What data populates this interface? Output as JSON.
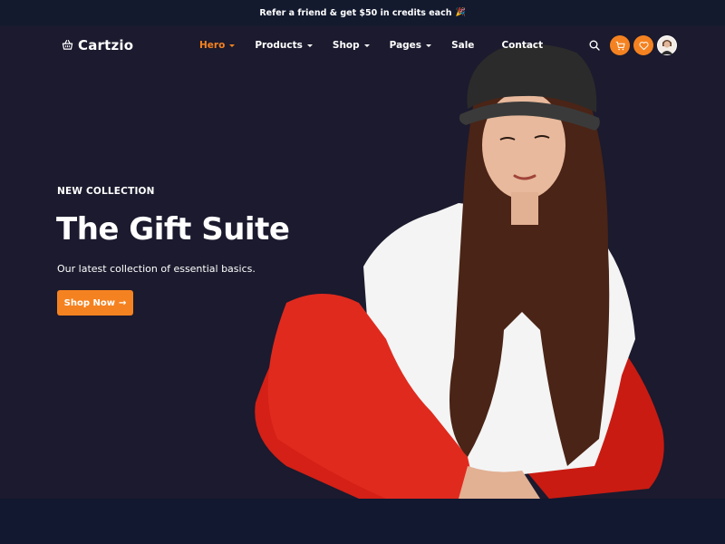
{
  "promo": {
    "text": "Refer a friend & get $50 in credits each",
    "emoji": "🎉"
  },
  "brand": {
    "name": "Cartzio",
    "icon": "basket-icon"
  },
  "nav": {
    "items": [
      {
        "label": "Hero",
        "active": true,
        "dropdown": true
      },
      {
        "label": "Products",
        "active": false,
        "dropdown": true
      },
      {
        "label": "Shop",
        "active": false,
        "dropdown": true
      },
      {
        "label": "Pages",
        "active": false,
        "dropdown": true
      },
      {
        "label": "Sale",
        "active": false,
        "dropdown": false
      },
      {
        "label": "Contact",
        "active": false,
        "dropdown": false
      }
    ],
    "actions": [
      "search-icon",
      "cart-icon",
      "heart-icon",
      "avatar"
    ]
  },
  "hero": {
    "eyebrow": "NEW COLLECTION",
    "title": "The Gift Suite",
    "subtitle": "Our latest collection of essential basics.",
    "cta_label": "Shop Now",
    "cta_icon": "arrow-right-icon"
  },
  "colors": {
    "accent": "#f58220",
    "hero_bg": "#1b1a2e",
    "page_bg": "#131a2e"
  }
}
